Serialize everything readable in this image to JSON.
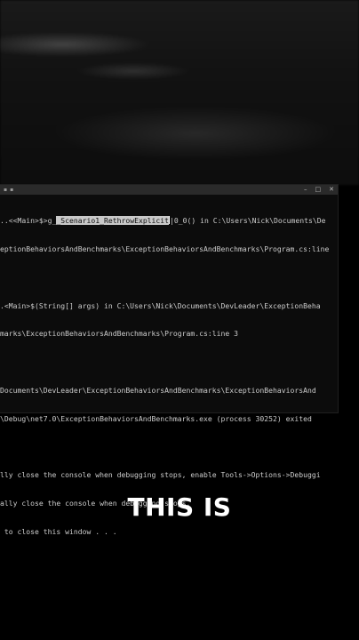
{
  "console": {
    "titlebar": {
      "left_glyphs": [
        "▪",
        "▪"
      ],
      "minimize": "–",
      "maximize": "□",
      "close": "✕"
    },
    "lines": [
      {
        "pre": "..<<Main>$>g_",
        "hl": "_Scenario1_RethrowExplicit",
        "post": "|0_0() in C:\\Users\\Nick\\Documents\\De"
      },
      {
        "text": "eptionBehaviorsAndBenchmarks\\ExceptionBehaviorsAndBenchmarks\\Program.cs:line"
      },
      {
        "text": ""
      },
      {
        "text": ".<Main>$(String[] args) in C:\\Users\\Nick\\Documents\\DevLeader\\ExceptionBeha"
      },
      {
        "text": "marks\\ExceptionBehaviorsAndBenchmarks\\Program.cs:line 3"
      },
      {
        "text": ""
      },
      {
        "text": "Documents\\DevLeader\\ExceptionBehaviorsAndBenchmarks\\ExceptionBehaviorsAnd"
      },
      {
        "text": "\\Debug\\net7.0\\ExceptionBehaviorsAndBenchmarks.exe (process 30252) exited"
      },
      {
        "text": ""
      },
      {
        "text": "lly close the console when debugging stops, enable Tools->Options->Debuggi"
      },
      {
        "text": "ally close the console when debugging stops."
      },
      {
        "text": " to close this window . . ."
      }
    ]
  },
  "caption": {
    "text": "THIS IS"
  }
}
